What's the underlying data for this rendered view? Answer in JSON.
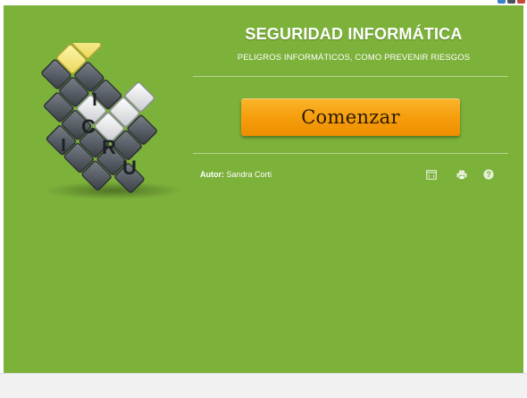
{
  "header": {
    "title": "SEGURIDAD INFORMÁTICA",
    "subtitle": "PELIGROS INFORMÁTICOS, COMO PREVENIR RIESGOS"
  },
  "logo": {
    "letters": [
      "C",
      "R",
      "U",
      "I",
      "I"
    ]
  },
  "actions": {
    "start_label": "Comenzar"
  },
  "author": {
    "label": "Autor:",
    "name": "Sandra Corti"
  },
  "tools": [
    {
      "icon": "embed-icon"
    },
    {
      "icon": "print-icon"
    },
    {
      "icon": "help-icon"
    }
  ],
  "colors": {
    "panel": "#7cb13a",
    "button": "#f59c0b",
    "accent_tile": "#f4e98a"
  }
}
